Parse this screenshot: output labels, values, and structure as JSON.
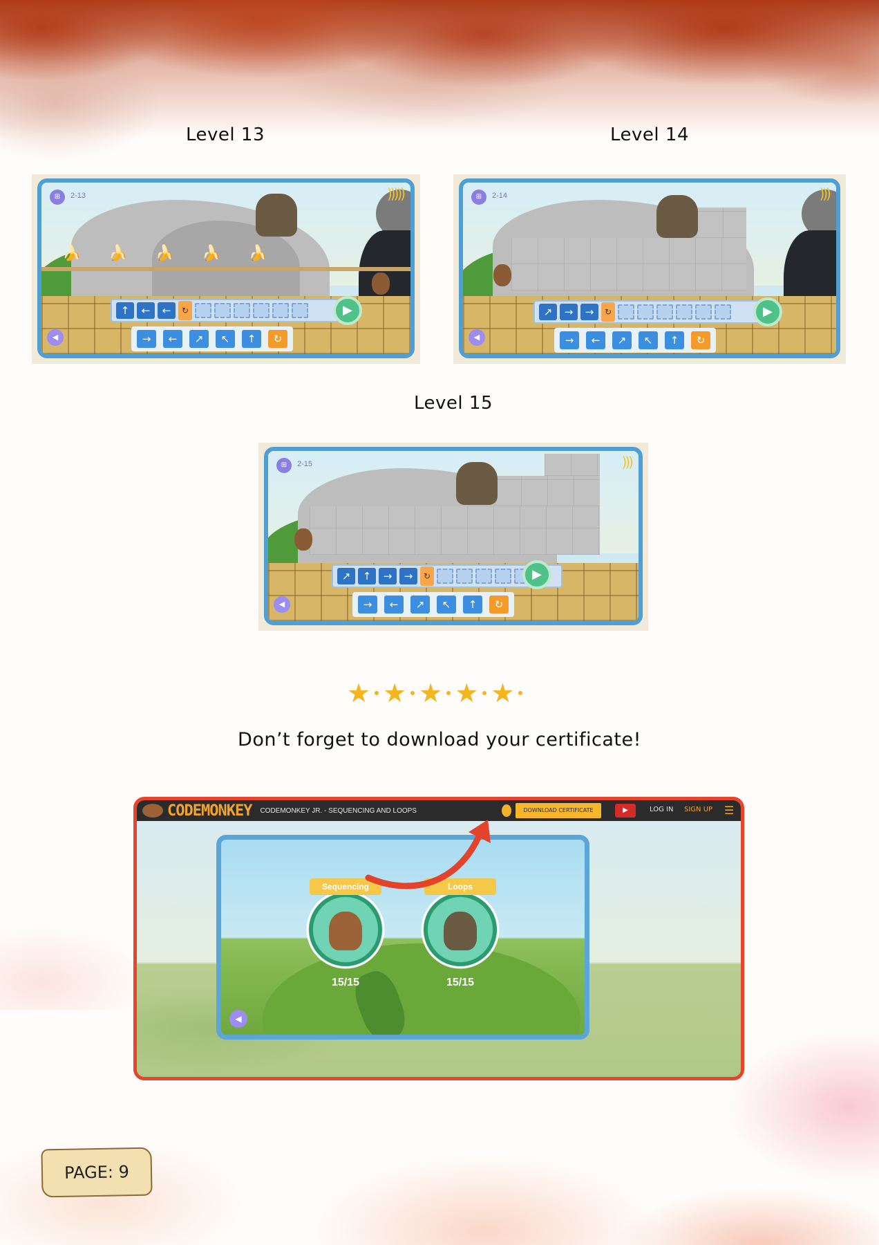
{
  "captions": {
    "level13": "Level 13",
    "level14": "Level 14",
    "level15": "Level 15"
  },
  "levels": [
    {
      "id": "level13",
      "number_label": "2-13",
      "program": [
        "↑",
        "←",
        "←"
      ],
      "loop_glyph": "↻",
      "slots": 6
    },
    {
      "id": "level14",
      "number_label": "2-14",
      "program": [
        "↗",
        "→",
        "→"
      ],
      "loop_glyph": "↻",
      "slots": 6
    },
    {
      "id": "level15",
      "number_label": "2-15",
      "program": [
        "↗",
        "↑",
        "→",
        "→"
      ],
      "loop_glyph": "↻",
      "slots": 5
    }
  ],
  "palette": [
    "→",
    "←",
    "↗",
    "↖",
    "↑",
    "↻"
  ],
  "icons": {
    "play": "play-icon",
    "sound": "sound-icon",
    "map": "map-icon",
    "banana": "banana-icon",
    "star": "star-icon"
  },
  "message": "Don’t forget to download your certificate!",
  "certificate": {
    "logo": "CODEMONKEY",
    "course_title": "CODEMONKEY JR. - SEQUENCING AND LOOPS",
    "download_button": "DOWNLOAD CERTIFICATE",
    "login": "LOG IN",
    "signup": "SIGN UP",
    "badges": [
      {
        "label": "Sequencing",
        "score": "15/15"
      },
      {
        "label": "Loops",
        "score": "15/15"
      }
    ]
  },
  "page_label": "PAGE: 9",
  "colors": {
    "frame_blue": "#4d9fd6",
    "code_tile": "#2f73c5",
    "play_green": "#4fc28a",
    "loop_orange": "#f39a28",
    "cert_border": "#e5452b",
    "star_gold": "#f6b51c"
  }
}
